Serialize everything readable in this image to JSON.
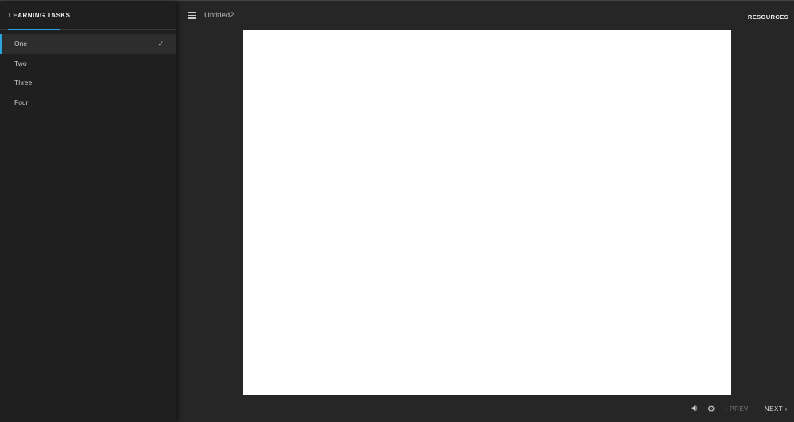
{
  "sidebar": {
    "title": "LEARNING TASKS",
    "items": [
      {
        "label": "One",
        "done": true
      },
      {
        "label": "Two"
      },
      {
        "label": "Three"
      },
      {
        "label": "Four"
      }
    ]
  },
  "header": {
    "title": "Untitled2",
    "resources": "RESOURCES"
  },
  "footer": {
    "prev": "PREV",
    "next": "NEXT"
  }
}
